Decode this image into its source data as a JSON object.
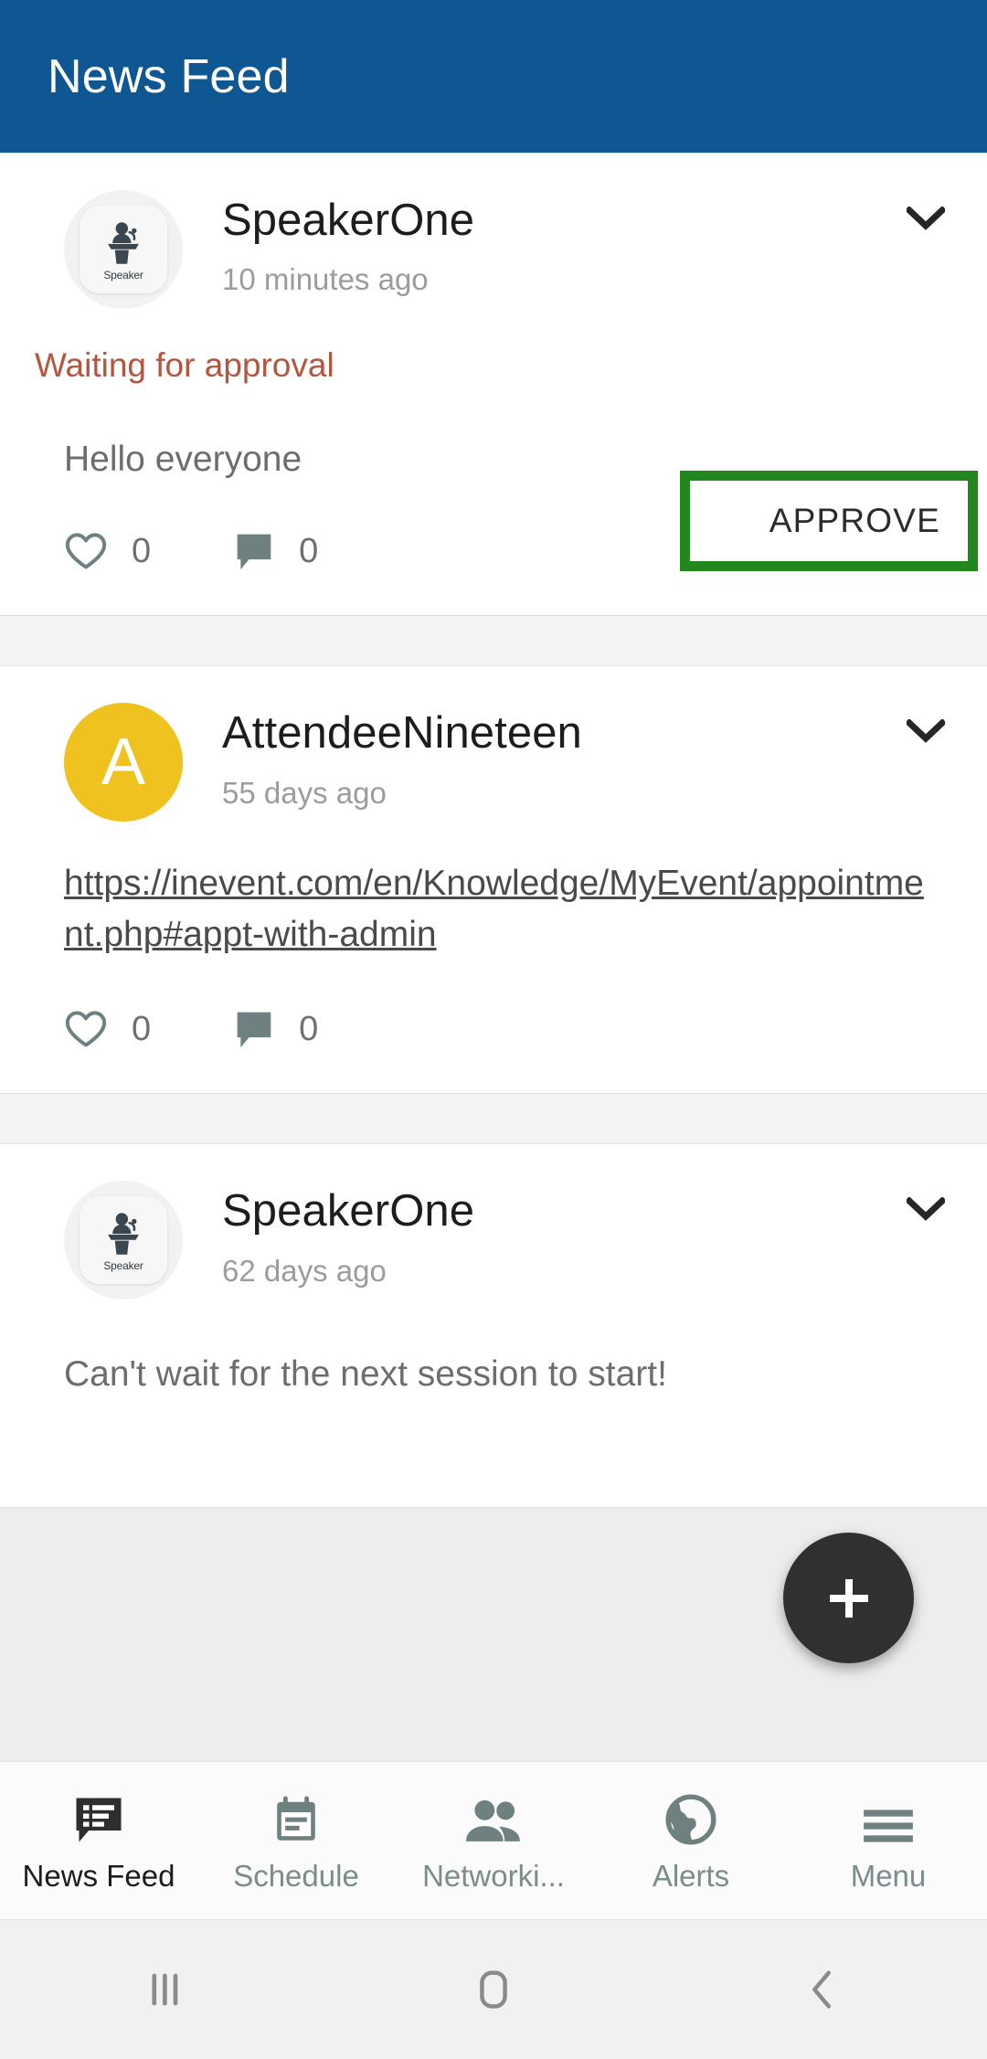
{
  "app": {
    "header_title": "News Feed",
    "header_color": "#0f5793",
    "accent_green": "#22871f",
    "fab_color": "#303030",
    "status_color": "#b2563f",
    "avatar_letter_color": "#f0c220"
  },
  "fab": {
    "label": "+",
    "icon": "plus-icon"
  },
  "posts": [
    {
      "author": "SpeakerOne",
      "time": "10 minutes ago",
      "avatar_type": "speaker-badge",
      "avatar_badge_label": "Speaker",
      "status": "Waiting for approval",
      "text": "Hello everyone",
      "likes": "0",
      "comments": "0",
      "approve_label": "APPROVE",
      "menu_icon": "chevron-down-icon"
    },
    {
      "author": "AttendeeNineteen",
      "time": "55 days ago",
      "avatar_type": "letter",
      "avatar_letter": "A",
      "link": "https://inevent.com/en/Knowledge/MyEvent/appointment.php#appt-with-admin",
      "likes": "0",
      "comments": "0",
      "menu_icon": "chevron-down-icon"
    },
    {
      "author": "SpeakerOne",
      "time": "62 days ago",
      "avatar_type": "speaker-badge",
      "avatar_badge_label": "Speaker",
      "text": "Can't wait for the next session to start!",
      "menu_icon": "chevron-down-icon"
    }
  ],
  "bottom_nav": {
    "items": [
      {
        "label": "News Feed",
        "icon": "news-feed-icon",
        "active": true
      },
      {
        "label": "Schedule",
        "icon": "calendar-icon",
        "active": false
      },
      {
        "label": "Networki...",
        "icon": "people-icon",
        "active": false
      },
      {
        "label": "Alerts",
        "icon": "globe-icon",
        "active": false
      },
      {
        "label": "Menu",
        "icon": "hamburger-icon",
        "active": false
      }
    ]
  },
  "system_nav": {
    "recents": "recents-icon",
    "home": "home-icon",
    "back": "back-icon"
  }
}
